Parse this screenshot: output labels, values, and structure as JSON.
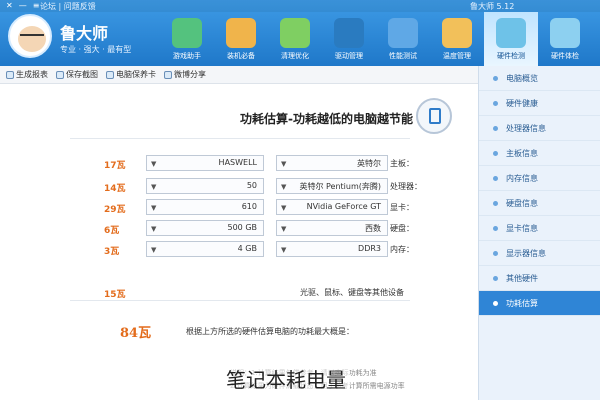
{
  "titlebar": {
    "left_text": "论坛 | 问题反馈",
    "right_text": "鲁大师 5.12"
  },
  "brand": {
    "name": "鲁大师",
    "slogan": "专业 · 强大 · 最有型"
  },
  "nav": [
    {
      "label": "游戏助手",
      "color": "#54c27e"
    },
    {
      "label": "装机必备",
      "color": "#f0b44b"
    },
    {
      "label": "清理优化",
      "color": "#7fcf62"
    },
    {
      "label": "驱动管理",
      "color": "#2a7bc0"
    },
    {
      "label": "性能测试",
      "color": "#5fa8e6"
    },
    {
      "label": "温度管理",
      "color": "#f2c05a"
    },
    {
      "label": "硬件检测",
      "color": "#6ec2e8",
      "active": true
    },
    {
      "label": "硬件体检",
      "color": "#8dd0f0"
    }
  ],
  "toolbar": {
    "items": [
      "生成报表",
      "保存截图",
      "电脑保养卡",
      "微博分享"
    ]
  },
  "sidebar": {
    "items": [
      {
        "label": "电脑概览"
      },
      {
        "label": "硬件健康"
      },
      {
        "label": "处理器信息"
      },
      {
        "label": "主板信息"
      },
      {
        "label": "内存信息"
      },
      {
        "label": "硬盘信息"
      },
      {
        "label": "显卡信息"
      },
      {
        "label": "显示器信息"
      },
      {
        "label": "其他硬件"
      },
      {
        "label": "功耗估算",
        "active": true
      }
    ]
  },
  "main": {
    "title": "功耗估算-功耗越低的电脑越节能",
    "rows": [
      {
        "label": "主板：",
        "brand": "英特尔",
        "model": "HASWELL",
        "watt": "17瓦"
      },
      {
        "label": "处理器：",
        "brand": "英特尔 Pentium(奔腾)",
        "model": "50",
        "watt": "14瓦"
      },
      {
        "label": "显卡：",
        "brand": "NVidia GeForce GT",
        "model": "610",
        "watt": "29瓦"
      },
      {
        "label": "硬盘：",
        "brand": "西数",
        "model": "500 GB",
        "watt": "6瓦"
      },
      {
        "label": "内存：",
        "brand": "DDR3",
        "model": "4 GB",
        "watt": "3瓦"
      }
    ],
    "extra": {
      "text": "光驱、鼠标、键盘等其他设备",
      "watt": "15瓦"
    },
    "total": {
      "value": "84瓦",
      "note": "根据上方所选的硬件估算电脑的功耗最大概是："
    },
    "footnotes": [
      "说明：1.计算结果仅供参考，请以实际功耗为准",
      "2.计算结果为硬件满载状态，用于参考计算所需电源功率"
    ]
  },
  "caption": "笔记本耗电量"
}
